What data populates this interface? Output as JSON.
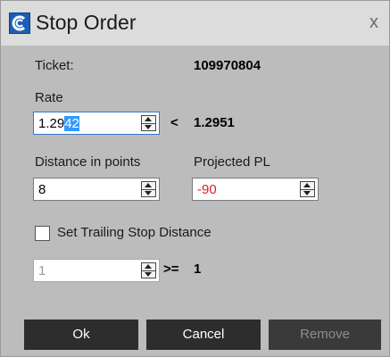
{
  "dialog": {
    "title": "Stop Order",
    "close_glyph": "x",
    "app_icon": "app-logo-icon"
  },
  "ticket": {
    "label": "Ticket:",
    "value": "109970804"
  },
  "rate": {
    "label": "Rate",
    "value_prefix": "1.29",
    "value_selected": "42",
    "compare_symbol": "<",
    "compare_value": "1.2951"
  },
  "distance": {
    "label": "Distance in points",
    "value": "8"
  },
  "projected_pl": {
    "label": "Projected PL",
    "value": "-90",
    "color": "#e02020"
  },
  "trailing": {
    "checkbox_label": "Set Trailing Stop Distance",
    "checked": false,
    "value": "1",
    "compare_symbol": ">=",
    "compare_value": "1"
  },
  "buttons": {
    "ok": "Ok",
    "cancel": "Cancel",
    "remove": "Remove"
  },
  "colors": {
    "accent": "#3399ff",
    "button_bg": "#2d2d2d",
    "panel_bg": "#bcbcbc"
  }
}
